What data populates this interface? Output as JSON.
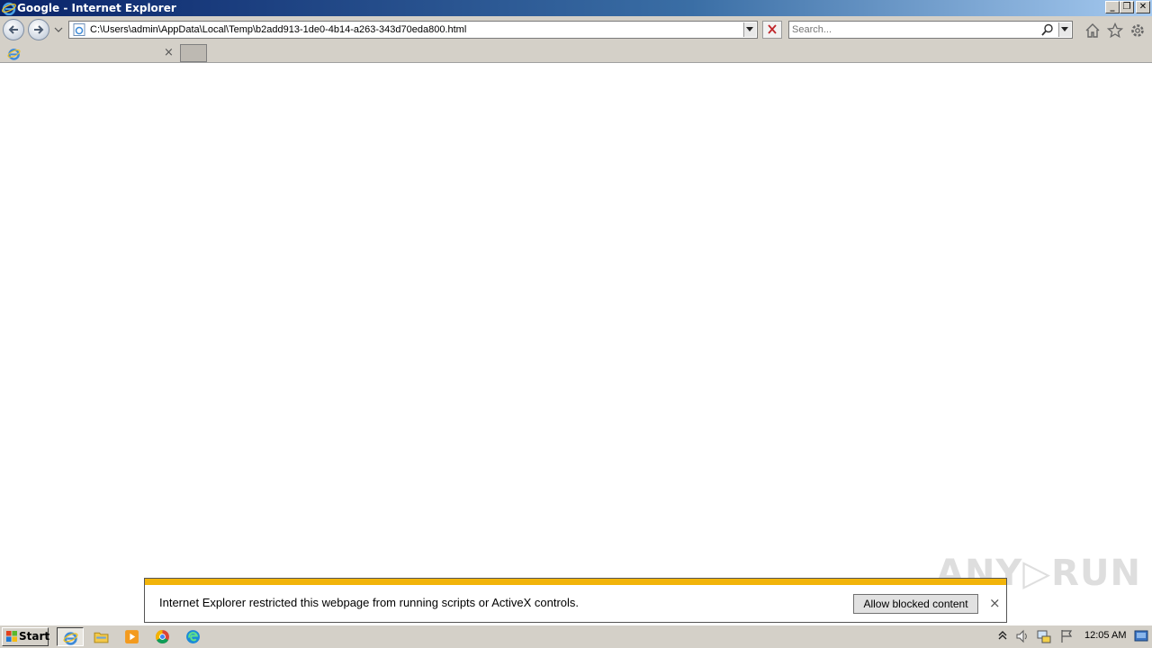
{
  "window": {
    "title": "Google - Internet Explorer",
    "controls": [
      "_",
      "❐",
      "✕"
    ]
  },
  "navbar": {
    "address": "C:\\Users\\admin\\AppData\\Local\\Temp\\b2add913-1de0-4b14-a263-343d70eda800.html",
    "search_placeholder": "Search..."
  },
  "tabs": [
    {
      "label": "",
      "close": "×"
    }
  ],
  "notification": {
    "message": "Internet Explorer restricted this webpage from running scripts or ActiveX controls.",
    "button_label": "Allow blocked content",
    "close": "×",
    "bar_color": "#f2b40a"
  },
  "watermark": "ANY▷RUN",
  "taskbar": {
    "start_label": "Start",
    "apps": [
      "internet-explorer",
      "file-explorer",
      "media-player",
      "chrome",
      "edge"
    ],
    "clock": "12:05 AM"
  }
}
